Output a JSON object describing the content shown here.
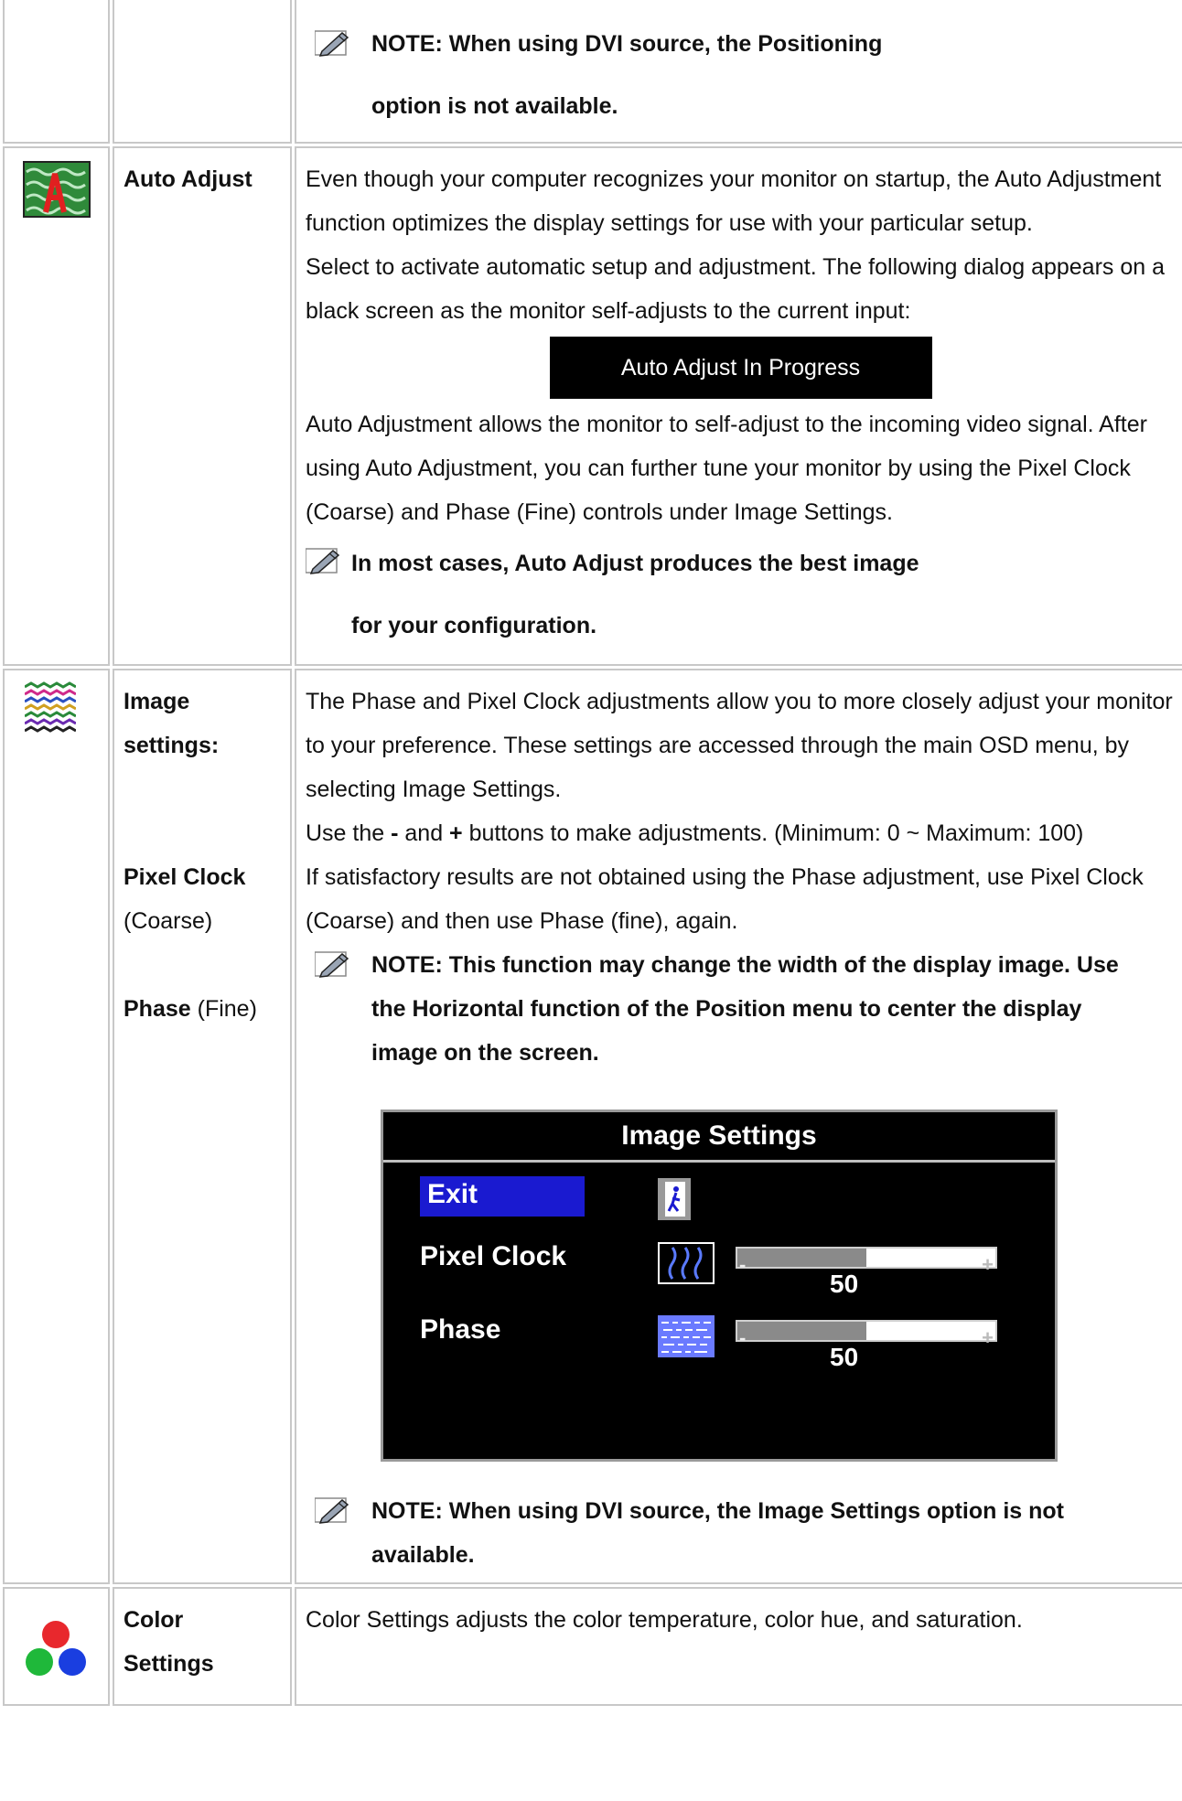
{
  "rows": [
    {
      "note": "NOTE: When using DVI source, the Positioning option is not available."
    },
    {
      "label": "Auto Adjust",
      "para1": "Even though your computer recognizes your monitor on startup, the Auto Adjustment function optimizes the display settings for use with your particular setup.",
      "para2": "Select to activate automatic setup and adjustment. The following dialog appears on a black screen as the monitor self-adjusts to the current input:",
      "dialog_text": "Auto Adjust In Progress",
      "para3": "Auto Adjustment allows the monitor to self-adjust to the incoming video signal. After using Auto Adjustment, you can further tune your monitor by using the Pixel Clock (Coarse) and Phase (Fine) controls under Image Settings.",
      "note": "In most cases, Auto Adjust produces the best image for your configuration."
    },
    {
      "label_title": "Image settings:",
      "label_pixel_bold": "Pixel Clock",
      "label_pixel_rest": "(Coarse)",
      "label_phase_bold": "Phase",
      "label_phase_rest": "(Fine)",
      "para1": "The Phase and Pixel Clock adjustments allow you to more closely adjust your monitor to your preference. These settings are accessed through the main OSD menu, by selecting Image Settings.",
      "para2_pre": "Use the ",
      "para2_minus": "-",
      "para2_mid": " and ",
      "para2_plus": "+",
      "para2_post": " buttons to make adjustments. (Minimum: 0 ~ Maximum: 100)",
      "para3": "If satisfactory results are not obtained using the Phase adjustment, use Pixel Clock (Coarse) and then use Phase (fine), again.",
      "note1": "NOTE: This function may change the width of the display image. Use the Horizontal function of the Position menu to center the display image on the screen.",
      "osd": {
        "title": "Image Settings",
        "exit_label": "Exit",
        "pixel_clock_label": "Pixel Clock",
        "pixel_clock_value": "50",
        "pixel_clock_level": 0.5,
        "phase_label": "Phase",
        "phase_value": "50",
        "phase_level": 0.5,
        "minus": "-",
        "plus": "+"
      },
      "note2": "NOTE: When using DVI source, the Image Settings option is not available."
    },
    {
      "label": "Color Settings",
      "para1": "Color Settings adjusts the color temperature, color hue, and saturation."
    }
  ],
  "colors": {
    "red_dot": "#e8282d",
    "green_dot": "#1fb83a",
    "blue_dot": "#1a3ee0",
    "osd_exit_bg": "#1a1ad0"
  }
}
